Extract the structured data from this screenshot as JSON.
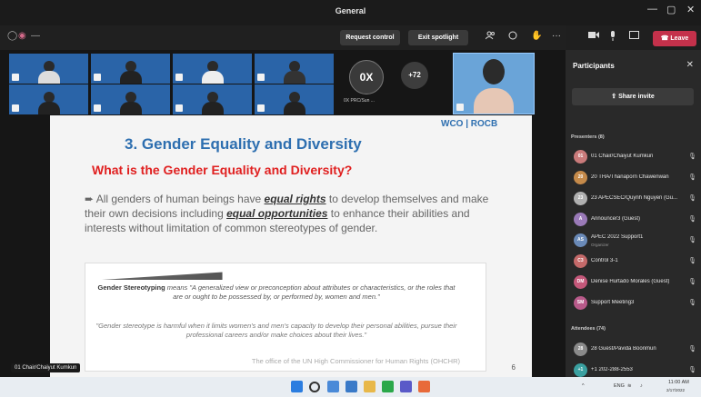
{
  "window": {
    "title": "General",
    "minimize": "—",
    "maximize": "▢",
    "close": "✕"
  },
  "toolbar": {
    "left_icons": [
      "◯",
      "◉",
      "—"
    ],
    "request_control": "Request control",
    "exit_spotlight": "Exit spotlight",
    "leave": "Leave",
    "people_icon": "people-icon",
    "chat_icon": "chat-icon",
    "hand_icon": "raise-hand-icon",
    "more_icon": "more-icon",
    "camera_icon": "camera-icon",
    "mic_icon": "mic-icon",
    "share_icon": "share-tray-icon"
  },
  "gallery": {
    "ox_initials": "0X",
    "ox_label": "0X PRC/Sun ...",
    "overflow_count": "+72"
  },
  "slide": {
    "title": "3. Gender Equality and Diversity",
    "subtitle": "What is the Gender Equality and Diversity?",
    "body_1": "All genders of human beings have ",
    "body_u1": "equal rights",
    "body_2": " to develop themselves and make their own decisions including ",
    "body_u2": "equal opportunities",
    "body_3": " to enhance their abilities and interests without limitation of common stereotypes of gender.",
    "quote_lead": "Gender Stereotyping",
    "quote_1": " means \"A generalized view or preconception about attributes or characteristics, or the roles that are or ought to be possessed by, or performed by, women and men.\"",
    "quote_2": "\"Gender stereotype is harmful when it limits women's and men's capacity to develop their personal abilities, pursue their professional careers and/or make choices about their lives.\"",
    "quote_source": "The office of the UN High Commissioner for Human Rights (OHCHR)",
    "logo": "WCO | ROCB",
    "page_number": "6"
  },
  "presenter_tag": "01 Chair/Chaiyut Kumkun",
  "participants": {
    "header": "Participants",
    "share_invite": "Share invite",
    "presenters_section": "Presenters (8)",
    "attendees_section": "Attendees (74)",
    "presenters": [
      {
        "initials": "01",
        "name": "01 Chair/Chaiyut Kumkun",
        "role": ""
      },
      {
        "initials": "20",
        "name": "20 THA/Thanaporn Chawenwan",
        "role": ""
      },
      {
        "initials": "23",
        "name": "23 APECSEC/Quynh Nguyen (Gu...",
        "role": ""
      },
      {
        "initials": "A",
        "name": "Announcer3 (Guest)",
        "role": ""
      },
      {
        "initials": "AS",
        "name": "APEC 2022 Support1",
        "role": "Organizer"
      },
      {
        "initials": "C3",
        "name": "Control 3-1",
        "role": ""
      },
      {
        "initials": "DM",
        "name": "Denise Hurtado Morales (Guest)",
        "role": ""
      },
      {
        "initials": "SM",
        "name": "Support Meeting3",
        "role": ""
      }
    ],
    "attendees": [
      {
        "initials": "28",
        "name": "28 Guest/Pavida Boonmun",
        "role": ""
      },
      {
        "initials": "+1",
        "name": "+1 202-288-2553",
        "role": ""
      }
    ]
  },
  "taskbar": {
    "time": "11:00 AM",
    "date": "2/17/2022",
    "tray_text": "ENG"
  }
}
